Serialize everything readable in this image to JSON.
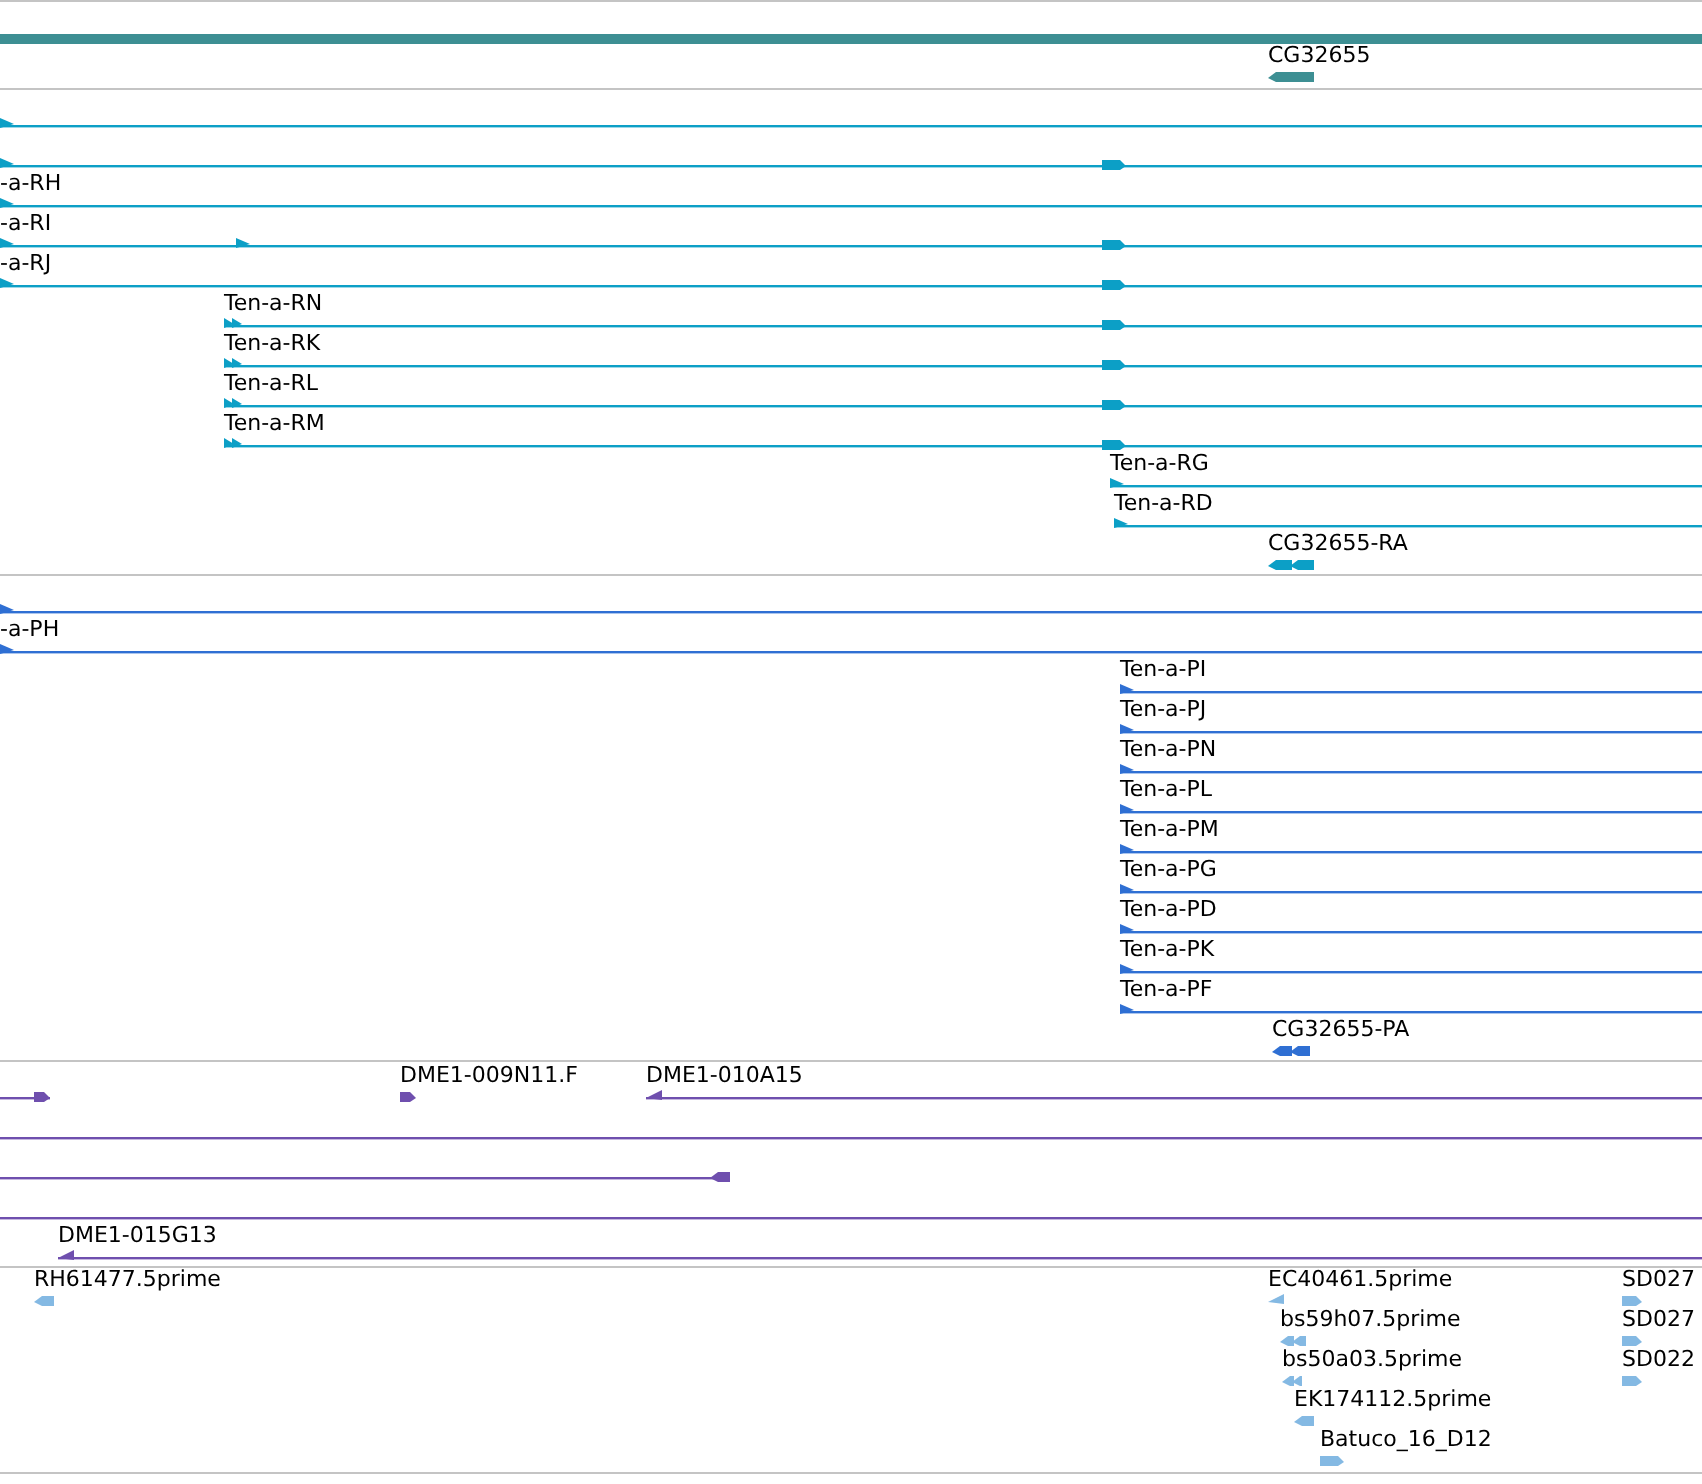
{
  "tracks": [
    {
      "color": "#3d8f93",
      "features": [
        {
          "kind": "bar"
        },
        {
          "kind": "glyph",
          "label": "CG32655"
        }
      ]
    },
    {
      "color": "#0c9fc6",
      "features": [
        {
          "kind": "line"
        },
        {
          "kind": "line"
        },
        {
          "kind": "line",
          "label": "-a-RH"
        },
        {
          "kind": "line",
          "label": "-a-RI"
        },
        {
          "kind": "line",
          "label": "-a-RJ"
        },
        {
          "kind": "line",
          "label": "Ten-a-RN"
        },
        {
          "kind": "line",
          "label": "Ten-a-RK"
        },
        {
          "kind": "line",
          "label": "Ten-a-RL"
        },
        {
          "kind": "line",
          "label": "Ten-a-RM"
        },
        {
          "kind": "line",
          "label": "Ten-a-RG"
        },
        {
          "kind": "line",
          "label": "Ten-a-RD"
        },
        {
          "kind": "glyph",
          "label": "CG32655-RA"
        }
      ]
    },
    {
      "color": "#2f6fd3",
      "features": [
        {
          "kind": "line"
        },
        {
          "kind": "line",
          "label": "-a-PH"
        },
        {
          "kind": "line",
          "label": "Ten-a-PI"
        },
        {
          "kind": "line",
          "label": "Ten-a-PJ"
        },
        {
          "kind": "line",
          "label": "Ten-a-PN"
        },
        {
          "kind": "line",
          "label": "Ten-a-PL"
        },
        {
          "kind": "line",
          "label": "Ten-a-PM"
        },
        {
          "kind": "line",
          "label": "Ten-a-PG"
        },
        {
          "kind": "line",
          "label": "Ten-a-PD"
        },
        {
          "kind": "line",
          "label": "Ten-a-PK"
        },
        {
          "kind": "line",
          "label": "Ten-a-PF"
        },
        {
          "kind": "glyph",
          "label": "CG32655-PA"
        }
      ]
    },
    {
      "color": "#6f4fae",
      "features": [
        {
          "kind": "line"
        },
        {
          "kind": "glyph",
          "label": "DME1-009N11.F"
        },
        {
          "kind": "line",
          "label": "DME1-010A15"
        },
        {
          "kind": "line"
        },
        {
          "kind": "line"
        },
        {
          "kind": "line"
        },
        {
          "kind": "line",
          "label": "DME1-015G13"
        }
      ]
    },
    {
      "color": "#84b9e3",
      "features": [
        {
          "kind": "glyph",
          "label": "RH61477.5prime"
        },
        {
          "kind": "glyph",
          "label": "EC40461.5prime"
        },
        {
          "kind": "glyph",
          "label": "bs59h07.5prime"
        },
        {
          "kind": "glyph",
          "label": "bs50a03.5prime"
        },
        {
          "kind": "glyph",
          "label": "EK174112.5prime"
        },
        {
          "kind": "glyph",
          "label": "Batuco_16_D12"
        },
        {
          "kind": "glyph",
          "label": "SD027"
        },
        {
          "kind": "glyph",
          "label": "SD027"
        },
        {
          "kind": "glyph",
          "label": "SD022"
        }
      ]
    }
  ]
}
